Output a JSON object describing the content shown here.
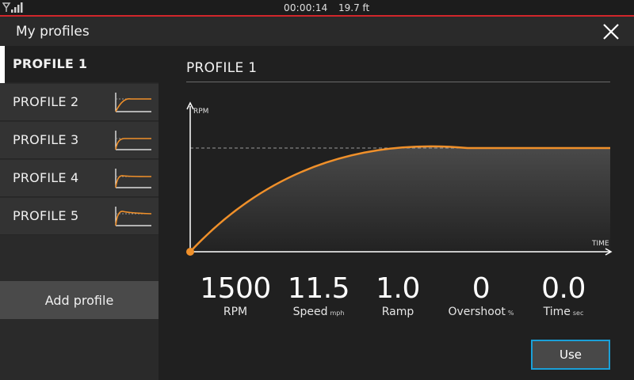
{
  "status": {
    "time": "00:00:14",
    "depth": "19.7 ft"
  },
  "header": {
    "title": "My profiles"
  },
  "sidebar": {
    "items": [
      {
        "label": "PROFILE 1",
        "active": true
      },
      {
        "label": "PROFILE 2",
        "active": false
      },
      {
        "label": "PROFILE 3",
        "active": false
      },
      {
        "label": "PROFILE 4",
        "active": false
      },
      {
        "label": "PROFILE 5",
        "active": false
      }
    ],
    "add_label": "Add profile"
  },
  "main": {
    "title": "PROFILE 1",
    "stats": [
      {
        "value": "1500",
        "label": "RPM",
        "unit": ""
      },
      {
        "value": "11.5",
        "label": "Speed",
        "unit": "mph"
      },
      {
        "value": "1.0",
        "label": "Ramp",
        "unit": ""
      },
      {
        "value": "0",
        "label": "Overshoot",
        "unit": "%"
      },
      {
        "value": "0.0",
        "label": "Time",
        "unit": "sec"
      }
    ],
    "use_label": "Use"
  },
  "chart_data": {
    "type": "line",
    "ylabel": "RPM",
    "xlabel": "TIME",
    "curve_color": "#f0902a",
    "target_line_color": "#9a9a9a"
  },
  "colors": {
    "accent_red": "#d1262b",
    "accent_blue": "#1aa0d8",
    "curve_orange": "#f0902a"
  }
}
